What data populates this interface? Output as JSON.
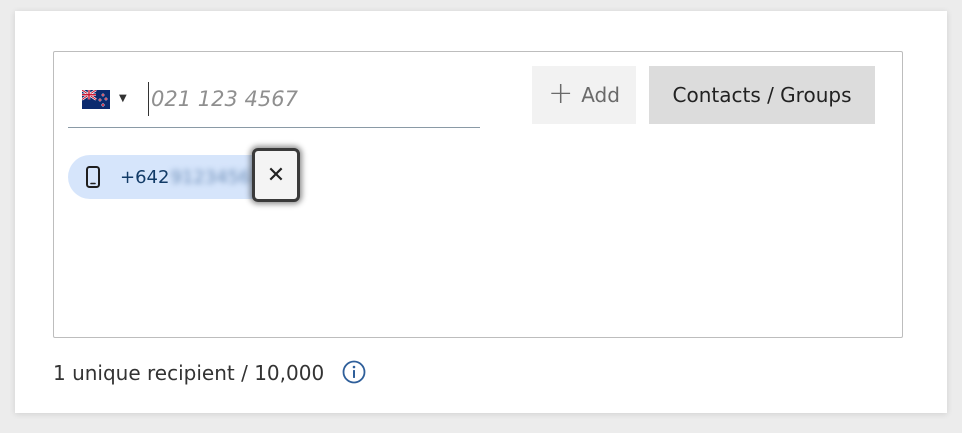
{
  "phone_field": {
    "country_flag": "new-zealand-flag",
    "placeholder": "021 123 4567",
    "value": ""
  },
  "add_button": {
    "icon": "plus-icon",
    "label": "Add"
  },
  "contacts_button": {
    "label": "Contacts / Groups"
  },
  "recipients": [
    {
      "icon": "mobile-phone-icon",
      "number_visible": "+642",
      "number_obscured": "91234567"
    }
  ],
  "footer": {
    "count_text": "1 unique recipient / 10,000",
    "info_icon": "info-icon"
  },
  "colors": {
    "chip_background": "#d6e5fb",
    "chip_text": "#123b67",
    "info_icon": "#2f5f9a",
    "contacts_button_bg": "#dcdcdc",
    "add_button_bg": "#f2f2f2"
  }
}
